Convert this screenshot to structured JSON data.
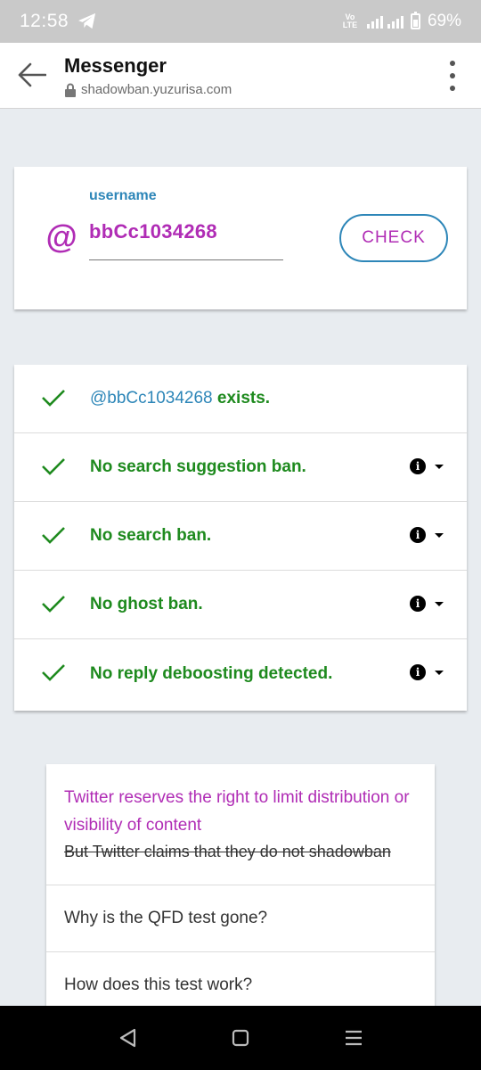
{
  "status_bar": {
    "time": "12:58",
    "network": "VoD LTE",
    "signal": "4G",
    "battery": "69%"
  },
  "app_bar": {
    "title": "Messenger",
    "url": "shadowban.yuzurisa.com"
  },
  "form": {
    "at_symbol": "@",
    "label": "username",
    "value": "bbCc1034268",
    "check_button": "CHECK"
  },
  "results": [
    {
      "username": "@bbCc1034268",
      "text": " exists.",
      "has_info": false
    },
    {
      "text": "No search suggestion ban.",
      "has_info": true
    },
    {
      "text": "No search ban.",
      "has_info": true
    },
    {
      "text": "No ghost ban.",
      "has_info": true
    },
    {
      "text": "No reply deboosting detected.",
      "has_info": true
    }
  ],
  "faq": {
    "notice": "Twitter reserves the right to limit distribution or visibility of content",
    "notice_strike": "But Twitter claims that they do not shadowban",
    "q1": "Why is the QFD test gone?",
    "q2": "How does this test work?"
  },
  "colors": {
    "accent_blue": "#2d86b8",
    "accent_purple": "#b02cb5",
    "success_green": "#1e8a1e"
  }
}
